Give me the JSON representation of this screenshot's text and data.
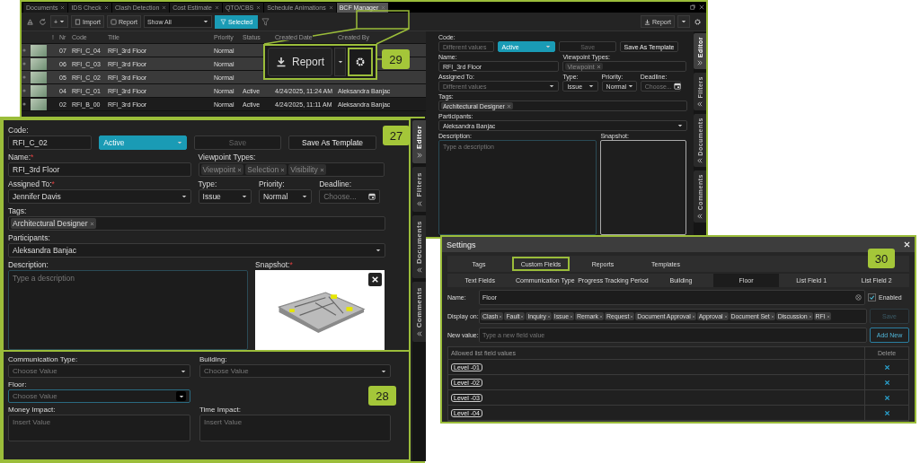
{
  "app_window": {
    "tabs": [
      {
        "label": "Documents",
        "selected": false
      },
      {
        "label": "IDS Check",
        "selected": false
      },
      {
        "label": "Clash Detection",
        "selected": false
      },
      {
        "label": "Cost Estimate",
        "selected": false
      },
      {
        "label": "QTO/CBS",
        "selected": false
      },
      {
        "label": "Schedule Animations",
        "selected": false
      },
      {
        "label": "BCF Manager",
        "selected": true
      }
    ],
    "toolbar": {
      "add": "+",
      "import": "Import",
      "report": "Report",
      "filter": "Show All",
      "selected_filter": "Selected",
      "report_menu": "Report"
    },
    "table": {
      "columns": [
        "!",
        "Nr",
        "Code",
        "Title",
        "Priority",
        "Status",
        "Created Date",
        "Created By"
      ],
      "rows": [
        {
          "selected": true,
          "nr": "07",
          "code": "RFI_C_04",
          "title": "RFI_3rd Floor",
          "priority": "Normal"
        },
        {
          "selected": true,
          "nr": "06",
          "code": "RFI_C_03",
          "title": "RFI_3rd Floor",
          "priority": "Normal"
        },
        {
          "selected": true,
          "nr": "05",
          "code": "RFI_C_02",
          "title": "RFI_3rd Floor",
          "priority": "Normal"
        },
        {
          "selected": true,
          "nr": "04",
          "code": "RFI_C_01",
          "title": "RFI_3rd Floor",
          "priority": "Normal",
          "status": "Active",
          "created_date": "4/24/2025, 11:24 AM",
          "created_by": "Aleksandra Banjac"
        },
        {
          "selected": false,
          "nr": "02",
          "code": "RFI_B_00",
          "title": "RFI_3rd Floor",
          "priority": "Normal",
          "status": "Active",
          "created_date": "4/24/2025, 11:11 AM",
          "created_by": "Aleksandra Banjac"
        }
      ]
    },
    "editor": {
      "code": {
        "label": "Code:",
        "placeholder": "Different values"
      },
      "status": "Active",
      "save": {
        "label": "Save",
        "disabled": true
      },
      "template": "Save As Template",
      "name": {
        "label": "Name:",
        "value": "RFI_3rd Floor"
      },
      "viewpoint_types": {
        "label": "Viewpoint Types:",
        "disabled": true,
        "chips": [
          "Viewpoint"
        ]
      },
      "assigned": {
        "label": "Assigned To:",
        "placeholder": "Different values"
      },
      "type": {
        "label": "Type:",
        "value": "Issue"
      },
      "priority": {
        "label": "Priority:",
        "value": "Normal"
      },
      "deadline": {
        "label": "Deadline:",
        "placeholder": "Choose..."
      },
      "tags": {
        "label": "Tags:",
        "disabled": false,
        "chips": [
          "Architectural Designer"
        ]
      },
      "participants": {
        "label": "Participants:",
        "value": "Aleksandra Banjac"
      },
      "description": {
        "label": "Description:",
        "placeholder": "Type a description"
      },
      "snapshot": {
        "label": "Snapshot:",
        "has_image": false
      }
    },
    "side_tabs": [
      {
        "label": "Editor",
        "expanded": true
      },
      {
        "label": "Filters",
        "expanded": false
      },
      {
        "label": "Documents",
        "expanded": false
      },
      {
        "label": "Comments",
        "expanded": false
      }
    ]
  },
  "report_callout": {
    "badge": "29",
    "report": "Report"
  },
  "editor_zoom": {
    "badge": "27",
    "editor": {
      "code": {
        "label": "Code:",
        "value": "RFI_C_02"
      },
      "status": "Active",
      "save": {
        "label": "Save",
        "disabled": true
      },
      "template": "Save As Template",
      "name": {
        "label": "Name:",
        "required_mark": "*",
        "value": "RFI_3rd Floor"
      },
      "viewpoint_types": {
        "label": "Viewpoint Types:",
        "disabled": true,
        "chips": [
          "Viewpoint",
          "Selection",
          "Visibility"
        ]
      },
      "assigned": {
        "label": "Assigned To:",
        "required_mark": "*",
        "value": "Jennifer Davis"
      },
      "type": {
        "label": "Type:",
        "value": "Issue"
      },
      "priority": {
        "label": "Priority:",
        "value": "Normal"
      },
      "deadline": {
        "label": "Deadline:",
        "placeholder": "Choose..."
      },
      "tags": {
        "label": "Tags:",
        "disabled": false,
        "chips": [
          "Architectural Designer"
        ]
      },
      "participants": {
        "label": "Participants:",
        "value": "Aleksandra Banjac"
      },
      "description": {
        "label": "Description:",
        "placeholder": "Type a description"
      },
      "snapshot": {
        "label": "Snapshot:",
        "required_mark": "*",
        "has_image": true
      }
    },
    "custom_fields": {
      "badge": "28",
      "fields": [
        {
          "kind": "dropdown",
          "label": "Communication Type:",
          "placeholder": "Choose Value",
          "focused": false
        },
        {
          "kind": "dropdown",
          "label": "Building:",
          "placeholder": "Choose Value",
          "focused": false
        },
        {
          "kind": "dropdown",
          "label": "Floor:",
          "placeholder": "Choose Value",
          "focused": true
        },
        {
          "kind": "text",
          "label": "Money Impact:",
          "placeholder": "Insert Value"
        },
        {
          "kind": "text",
          "label": "Time Impact:",
          "placeholder": "Insert Value"
        }
      ]
    },
    "side_tabs": [
      {
        "label": "Editor",
        "expanded": true
      },
      {
        "label": "Filters",
        "expanded": false
      },
      {
        "label": "Documents",
        "expanded": false
      },
      {
        "label": "Comments",
        "expanded": false
      }
    ]
  },
  "settings": {
    "title": "Settings",
    "badge": "30",
    "tabs": [
      {
        "label": "Tags",
        "selected": false
      },
      {
        "label": "Custom Fields",
        "selected": true
      },
      {
        "label": "Reports",
        "selected": false
      },
      {
        "label": "Templates",
        "selected": false
      }
    ],
    "subtabs": [
      {
        "label": "Text Fields",
        "selected": false
      },
      {
        "label": "Communication Type",
        "selected": false
      },
      {
        "label": "Progress Tracking Period",
        "selected": false
      },
      {
        "label": "Building",
        "selected": false
      },
      {
        "label": "Floor",
        "selected": true
      },
      {
        "label": "List Field 1",
        "selected": false
      },
      {
        "label": "List Field 2",
        "selected": false
      }
    ],
    "name": {
      "label": "Name:",
      "value": "Floor"
    },
    "enabled": {
      "label": "Enabled",
      "checked": true
    },
    "display_on": {
      "label": "Display on:",
      "chips": [
        "Clash",
        "Fault",
        "Inquiry",
        "Issue",
        "Remark",
        "Request",
        "Document Approval",
        "Approval",
        "Document Set",
        "Discussion",
        "RFI"
      ]
    },
    "save": {
      "label": "Save",
      "disabled": true
    },
    "new_value": {
      "label": "New value:",
      "placeholder": "Type a new field value"
    },
    "add_new": "Add New",
    "list": {
      "columns": [
        "Allowed list field values",
        "Delete"
      ],
      "values": [
        "Level -01",
        "Level -02",
        "Level -03",
        "Level -04"
      ]
    }
  }
}
